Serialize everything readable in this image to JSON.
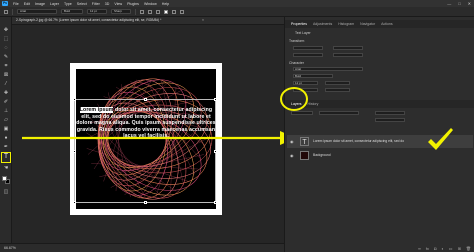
{
  "menubar": {
    "items": [
      "File",
      "Edit",
      "Image",
      "Layer",
      "Type",
      "Select",
      "Filter",
      "3D",
      "View",
      "Plugins",
      "Window",
      "Help"
    ],
    "window_controls": [
      "—",
      "□",
      "✕"
    ]
  },
  "options": {
    "font_family": "Arial",
    "font_style": "Bold",
    "font_size": "12 pt",
    "antialias": "Sharp"
  },
  "document": {
    "tab_label": "2-Spirograph-2.jpg @ 66.7% (Lorem ipsum dolor sit amet, consectetur adipiscing elit, se, RGB/8#) *",
    "tab_close": "×",
    "zoom": "66.67%"
  },
  "text_layer": {
    "selected_text": "Lorem ipsum",
    "body_text": " dolor sit amet, consectetur adipiscing elit, sed do eiusmod tempor incididunt ut labore et dolore magna aliqua. Quis ipsum suspendisse ultrices gravida. Risus commodo viverra maecenas accumsan lacus vel facilisis."
  },
  "panels": {
    "top_tabs": [
      "Properties",
      "Adjustments",
      "Histogram",
      "Navigator",
      "Actions"
    ],
    "properties_title": "Text Layer",
    "transform_label": "Transform",
    "character_label": "Character",
    "character_font": "Arial",
    "character_style": "Bold",
    "character_size": "12 pt",
    "layer_tabs": [
      "Layers",
      "History"
    ],
    "layers": [
      {
        "name": "Lorem ipsum dolor sit amet, consectetur adipiscing elit, sed do",
        "kind": "text",
        "selected": true
      },
      {
        "name": "Background",
        "kind": "image",
        "selected": false
      }
    ]
  },
  "colors": {
    "highlight": "#f2f200",
    "accent": "#31a8ff"
  }
}
